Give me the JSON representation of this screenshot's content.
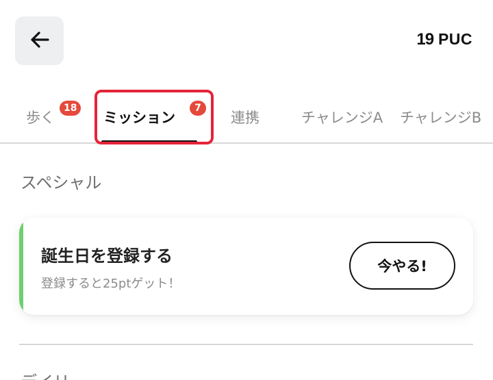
{
  "header": {
    "back_icon": "arrow-left-icon",
    "balance_value": "19",
    "balance_unit": "PUC"
  },
  "tabs": [
    {
      "label": "歩く",
      "badge": "18"
    },
    {
      "label": "ミッション",
      "badge": "7",
      "active": true
    },
    {
      "label": "連携"
    },
    {
      "label": "チャレンジA"
    },
    {
      "label": "チャレンジB"
    }
  ],
  "colors": {
    "badge": "#e5493b",
    "highlight": "#e5243a",
    "accent_green": "#6fcf70"
  },
  "sections": [
    {
      "title": "スペシャル",
      "card": {
        "title": "誕生日を登録する",
        "subtitle": "登録すると25ptゲット！",
        "button_label": "今やる!"
      }
    },
    {
      "title": "デイリー"
    }
  ]
}
